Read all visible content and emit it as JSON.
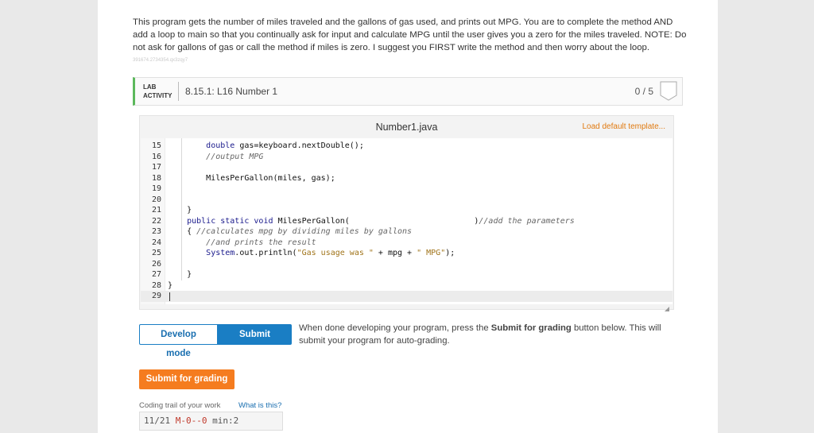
{
  "instructions": {
    "text": "This program gets the number of miles traveled and the gallons of gas used, and prints out MPG. You are to complete the method AND add a loop to main so that you continually ask for input and calculate MPG until the user gives you a zero for the miles traveled. NOTE: Do not ask for gallons of gas or call the method if miles is zero. I suggest you FIRST write the method and then worry about the loop.",
    "id_line": "391674.2734354.qx3zqy7"
  },
  "lab": {
    "tag_line1": "LAB",
    "tag_line2": "ACTIVITY",
    "title": "8.15.1: L16 Number 1",
    "score": "0 / 5"
  },
  "editor": {
    "file_name": "Number1.java",
    "load_template": "Load default template...",
    "lines": [
      {
        "num": "15",
        "text": "        double gas=keyboard.nextDouble();"
      },
      {
        "num": "16",
        "text": "        //output MPG"
      },
      {
        "num": "17",
        "text": ""
      },
      {
        "num": "18",
        "text": "        MilesPerGallon(miles, gas);"
      },
      {
        "num": "19",
        "text": ""
      },
      {
        "num": "20",
        "text": ""
      },
      {
        "num": "21",
        "text": "    }"
      },
      {
        "num": "22",
        "text": "    public static void MilesPerGallon(                          )//add the parameters"
      },
      {
        "num": "23",
        "text": "    { //calculates mpg by dividing miles by gallons"
      },
      {
        "num": "24",
        "text": "        //and prints the result"
      },
      {
        "num": "25",
        "text": "        System.out.println(\"Gas usage was \" + mpg + \" MPG\");"
      },
      {
        "num": "26",
        "text": ""
      },
      {
        "num": "27",
        "text": "    }"
      },
      {
        "num": "28",
        "text": "}"
      },
      {
        "num": "29",
        "text": ""
      }
    ]
  },
  "modes": {
    "develop_label": "Develop mode",
    "submit_label": "Submit mode",
    "note_before": "When done developing your program, press the ",
    "note_bold": "Submit for grading",
    "note_after": " button below. This will submit your program for auto-grading."
  },
  "submit_button": "Submit for grading",
  "trail": {
    "label": "Coding trail of your work",
    "link": "What is this?",
    "date": "11/21",
    "marks": "M-0--0",
    "min": "min:2"
  }
}
